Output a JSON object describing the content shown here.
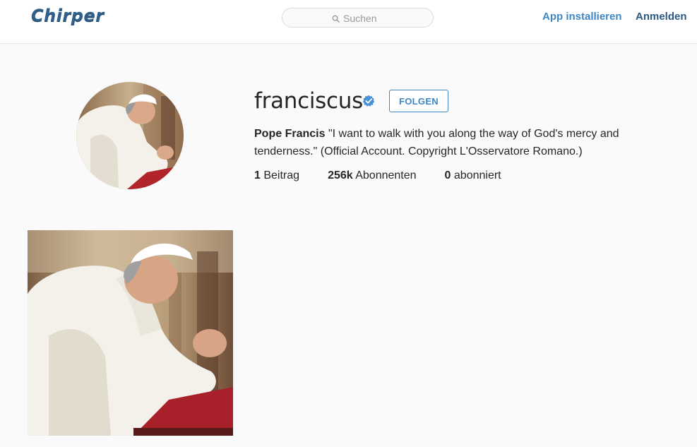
{
  "header": {
    "logo_text": "Chirper",
    "search": {
      "placeholder": "Suchen"
    },
    "install_label": "App installieren",
    "login_label": "Anmelden"
  },
  "profile": {
    "username": "franciscus",
    "verified": true,
    "follow_label": "FOLGEN",
    "bio_name": "Pope Francis",
    "bio_text": "\"I want to walk with you along the way of God's mercy and tenderness.\" (Official Account. Copyright L'Osservatore Romano.)",
    "stats": {
      "posts_count": "1",
      "posts_label": "Beitrag",
      "followers_count": "256k",
      "followers_label": "Abonnenten",
      "following_count": "0",
      "following_label": "abonniert"
    }
  },
  "icons": {
    "search": "search-icon",
    "verified": "verified-badge-icon"
  },
  "colors": {
    "accent": "#3f87c4",
    "logo": "#2f5f8a",
    "background": "#fafafa"
  }
}
